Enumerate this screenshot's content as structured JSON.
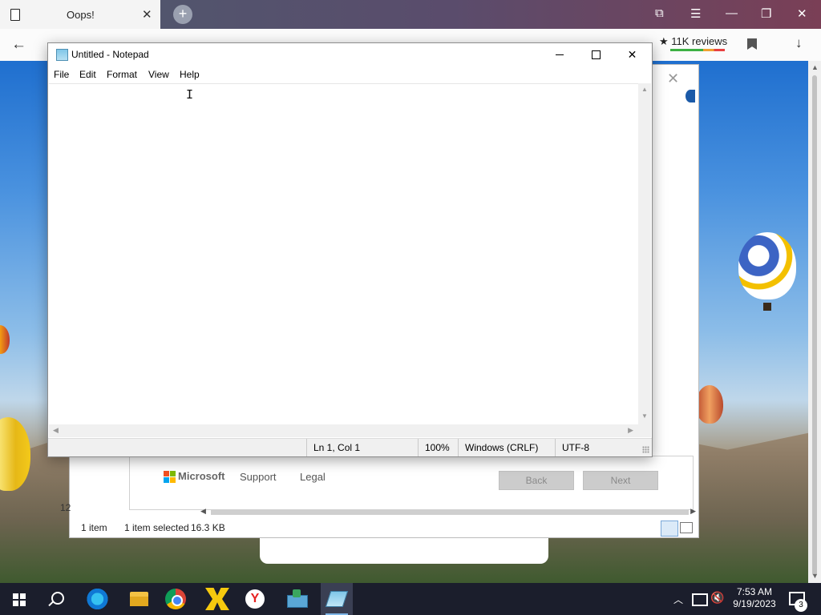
{
  "browser": {
    "tab_title": "Oops!",
    "tab_close": "✕",
    "new_tab": "+",
    "back": "←",
    "reviews": "★ 11K reviews",
    "download": "↓",
    "window_buttons": {
      "min": "—",
      "restore": "❐",
      "close": "✕"
    }
  },
  "explorer": {
    "status_items": "1 item",
    "status_selected": "1 item selected",
    "status_size": "16.3 KB",
    "left_number": "12"
  },
  "installer": {
    "close": "✕",
    "brand": "Microsoft",
    "links": [
      "Support",
      "Legal"
    ],
    "back_button": "Back",
    "next_button": "Next"
  },
  "notepad": {
    "title": "Untitled - Notepad",
    "menu": [
      "File",
      "Edit",
      "Format",
      "View",
      "Help"
    ],
    "content": "",
    "status": {
      "position": "Ln 1, Col 1",
      "zoom": "100%",
      "line_ending": "Windows (CRLF)",
      "encoding": "UTF-8"
    },
    "close": "✕"
  },
  "taskbar": {
    "apps": [
      "start-icon",
      "search-icon",
      "edge-icon",
      "file-explorer-icon",
      "chrome-icon",
      "xv-icon",
      "yandex-icon",
      "mail-icon",
      "notepad-icon"
    ],
    "time": "7:53 AM",
    "date": "9/19/2023",
    "notification_count": "3",
    "yandex_letter": "Y"
  }
}
